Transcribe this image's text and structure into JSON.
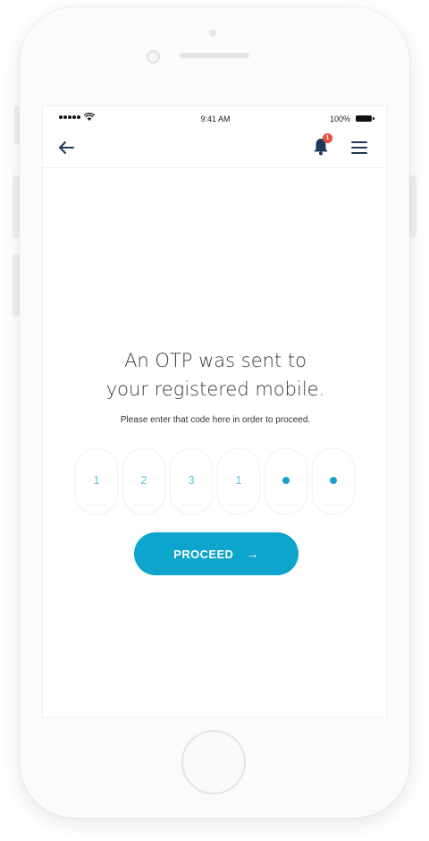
{
  "status_bar": {
    "time": "9:41 AM",
    "battery": "100%"
  },
  "header": {
    "notification_count": "1"
  },
  "main": {
    "headline_line1": "An OTP was sent to",
    "headline_line2": "your registered mobile.",
    "subline": "Please enter that code here in order to proceed.",
    "otp": [
      "1",
      "2",
      "3",
      "1",
      "•",
      "•"
    ],
    "proceed_label": "PROCEED",
    "proceed_arrow": "→"
  },
  "colors": {
    "accent": "#0ea5cc",
    "otp_digit": "#5ec5e0",
    "badge": "#e74c3c"
  },
  "icons": {
    "back": "arrow-left-icon",
    "notifications": "bell-icon",
    "menu": "hamburger-menu-icon"
  }
}
